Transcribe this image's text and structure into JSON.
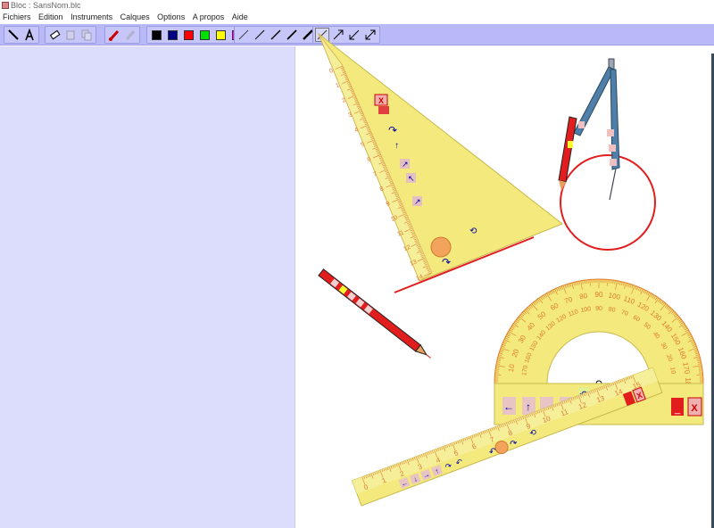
{
  "window": {
    "title": "Bloc : SansNom.blc"
  },
  "menu": [
    "Fichiers",
    "Edition",
    "Instruments",
    "Calques",
    "Options",
    "A propos",
    "Aide"
  ],
  "toolbar": {
    "colors": [
      "#000000",
      "#000080",
      "#ff0000",
      "#00e000",
      "#ffff00",
      "#ff00ff"
    ]
  },
  "protractor": {
    "outer_labels": [
      "10",
      "20",
      "30",
      "40",
      "50",
      "60",
      "70",
      "80",
      "90",
      "100",
      "110",
      "120",
      "130",
      "140",
      "150",
      "160",
      "170",
      "180"
    ],
    "inner_labels": [
      "170",
      "160",
      "150",
      "140",
      "130",
      "120",
      "110",
      "100",
      "90",
      "80",
      "70",
      "60",
      "50",
      "40",
      "30",
      "20",
      "10"
    ]
  },
  "ruler": {
    "labels": [
      "0",
      "1",
      "2",
      "3",
      "4",
      "5",
      "6",
      "7",
      "8",
      "9",
      "10",
      "11",
      "12",
      "13",
      "14",
      "15"
    ]
  },
  "set_square": {
    "labels": [
      "0",
      "1",
      "2",
      "3",
      "4",
      "5",
      "6",
      "7",
      "8",
      "9",
      "10",
      "11",
      "12",
      "13",
      "14"
    ]
  },
  "buttons": {
    "close": "X",
    "minimize": "_"
  }
}
